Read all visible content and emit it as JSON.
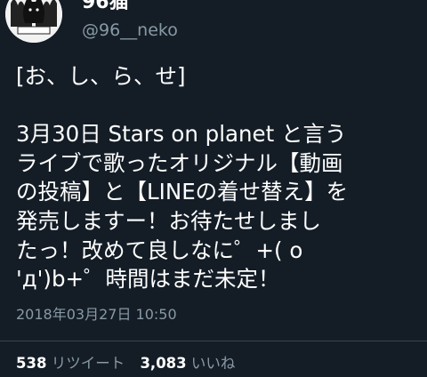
{
  "user": {
    "display_name": "96猫",
    "handle": "@96__neko"
  },
  "tweet": {
    "lines": [
      "[お、し、ら、せ]",
      "",
      "3月30日 Stars on planet と言う",
      "ライブで歌ったオリジナル【動画",
      "の投稿】と【LINEの着せ替え】を",
      "発売しますー！お待たせしまし",
      "たっ！改めて良しなに゜+( o",
      "'д')b+゜時間はまだ未定！"
    ],
    "timestamp": "2018年03月27日 10:50"
  },
  "stats": {
    "retweets": "538",
    "retweets_label": "リツイート",
    "likes": "3,083",
    "likes_label": "いいね"
  },
  "colors": {
    "background": "#141d26",
    "text": "#ffffff",
    "secondary": "#8899a6",
    "divider": "#38444d"
  },
  "icons": {
    "avatar": "cat-silhouette-avatar"
  }
}
